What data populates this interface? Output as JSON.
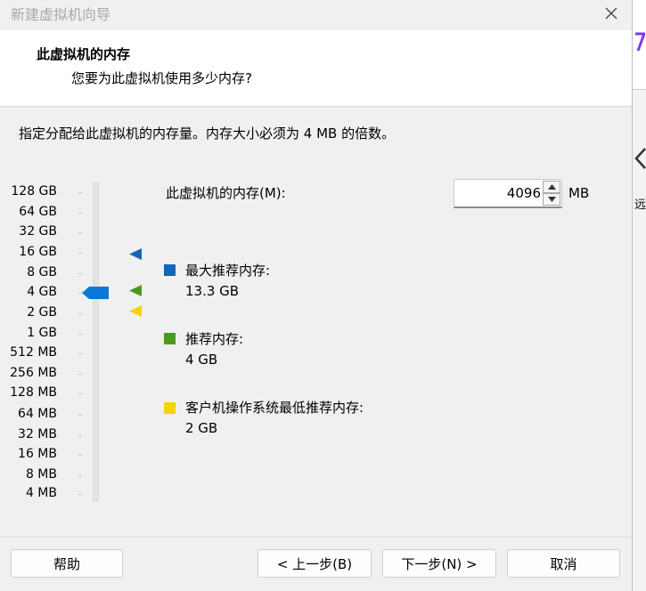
{
  "window": {
    "title": "新建虚拟机向导",
    "close_icon": "close-icon"
  },
  "header": {
    "title": "此虚拟机的内存",
    "subtitle": "您要为此虚拟机使用多少内存?"
  },
  "instruction": "指定分配给此虚拟机的内存量。内存大小必须为 4 MB 的倍数。",
  "memory_scale": {
    "labels": [
      "128 GB",
      "64 GB",
      "32 GB",
      "16 GB",
      "8 GB",
      "4 GB",
      "2 GB",
      "1 GB",
      "512 MB",
      "256 MB",
      "128 MB",
      "64 MB",
      "32 MB",
      "16 MB",
      "8 MB",
      "4 MB"
    ],
    "selected": "4 GB"
  },
  "memory_input": {
    "label": "此虚拟机的内存(M):",
    "value": "4096",
    "unit": "MB"
  },
  "legend": {
    "max": {
      "label": "最大推荐内存:",
      "value": "13.3 GB",
      "color": "#1565b8"
    },
    "recommended": {
      "label": "推荐内存:",
      "value": "4 GB",
      "color": "#4a9a1c"
    },
    "guest_min": {
      "label": "客户机操作系统最低推荐内存:",
      "value": "2 GB",
      "color": "#f3d300"
    }
  },
  "slider_color": "#0a78d7",
  "buttons": {
    "help": "帮助",
    "back": "< 上一步(B)",
    "next": "下一步(N) >",
    "cancel": "取消"
  },
  "background_window": {
    "partial_glyph": "远"
  }
}
